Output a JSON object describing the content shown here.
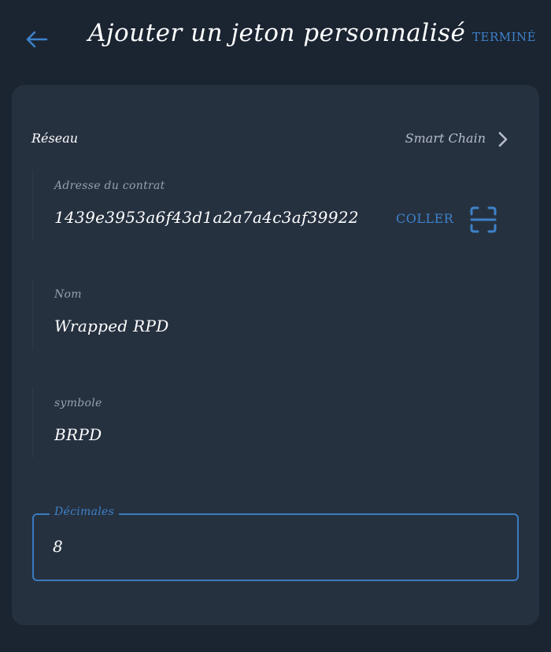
{
  "header": {
    "title": "Ajouter un jeton personnalisé",
    "done_label": "TERMINÉ",
    "back_icon": "arrow-left-icon"
  },
  "network": {
    "label": "Réseau",
    "value": "Smart Chain",
    "chevron_icon": "chevron-right-icon"
  },
  "contract_address": {
    "label": "Adresse du contrat",
    "value": "1439e3953a6f43d1a2a7a4c3af39922",
    "paste_label": "COLLER",
    "scan_icon": "qr-scan-icon"
  },
  "name": {
    "label": "Nom",
    "value": "Wrapped RPD"
  },
  "symbol": {
    "label": "symbole",
    "value": "BRPD"
  },
  "decimals": {
    "label": "Décimales",
    "value": "8"
  },
  "colors": {
    "background": "#1b2431",
    "card": "#263140",
    "accent": "#3d82c9",
    "label": "#97a1ae"
  }
}
